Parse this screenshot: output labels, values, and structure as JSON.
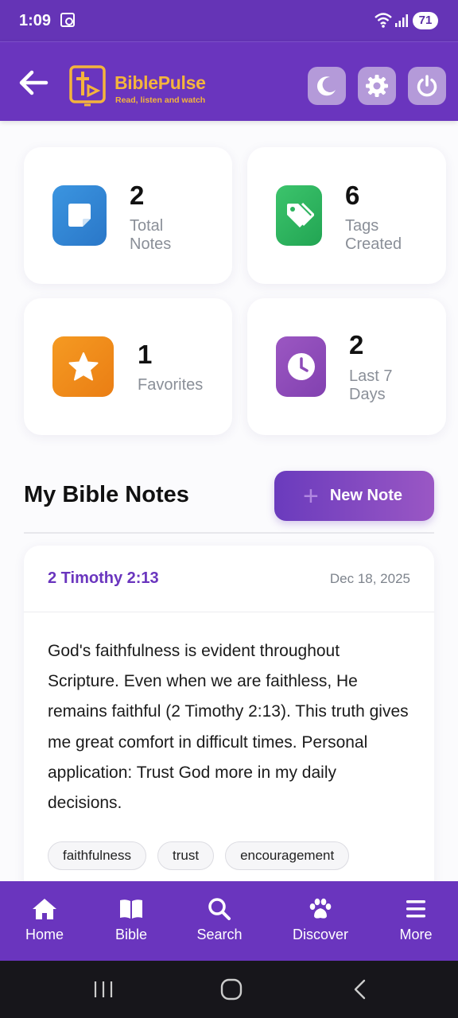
{
  "status_bar": {
    "time": "1:09",
    "battery": "71"
  },
  "header": {
    "brand": "BiblePulse",
    "tagline": "Read, listen and watch"
  },
  "stats": [
    {
      "value": "2",
      "label": "Total Notes",
      "icon": "note-icon",
      "color": "#2f86d4"
    },
    {
      "value": "6",
      "label": "Tags Created",
      "icon": "tag-icon",
      "color": "#2cb45e"
    },
    {
      "value": "1",
      "label": "Favorites",
      "icon": "star-icon",
      "color": "#f08a1c"
    },
    {
      "value": "2",
      "label": "Last 7 Days",
      "icon": "clock-icon",
      "color": "#8d4bb8"
    }
  ],
  "section": {
    "title": "My Bible Notes",
    "new_note_label": "New Note"
  },
  "note": {
    "reference": "2 Timothy 2:13",
    "date": "Dec 18, 2025",
    "body": "God's faithfulness is evident throughout Scripture. Even when we are faithless, He remains faithful (2 Timothy 2:13). This truth gives me great comfort in difficult times. Personal application: Trust God more in my daily decisions.",
    "tags": [
      "faithfulness",
      "trust",
      "encouragement"
    ]
  },
  "bottom_nav": [
    {
      "label": "Home",
      "icon": "home-icon"
    },
    {
      "label": "Bible",
      "icon": "book-icon"
    },
    {
      "label": "Search",
      "icon": "search-icon"
    },
    {
      "label": "Discover",
      "icon": "paw-icon"
    },
    {
      "label": "More",
      "icon": "menu-icon"
    }
  ],
  "colors": {
    "primary": "#6a35be",
    "accent": "#f4b43c"
  }
}
